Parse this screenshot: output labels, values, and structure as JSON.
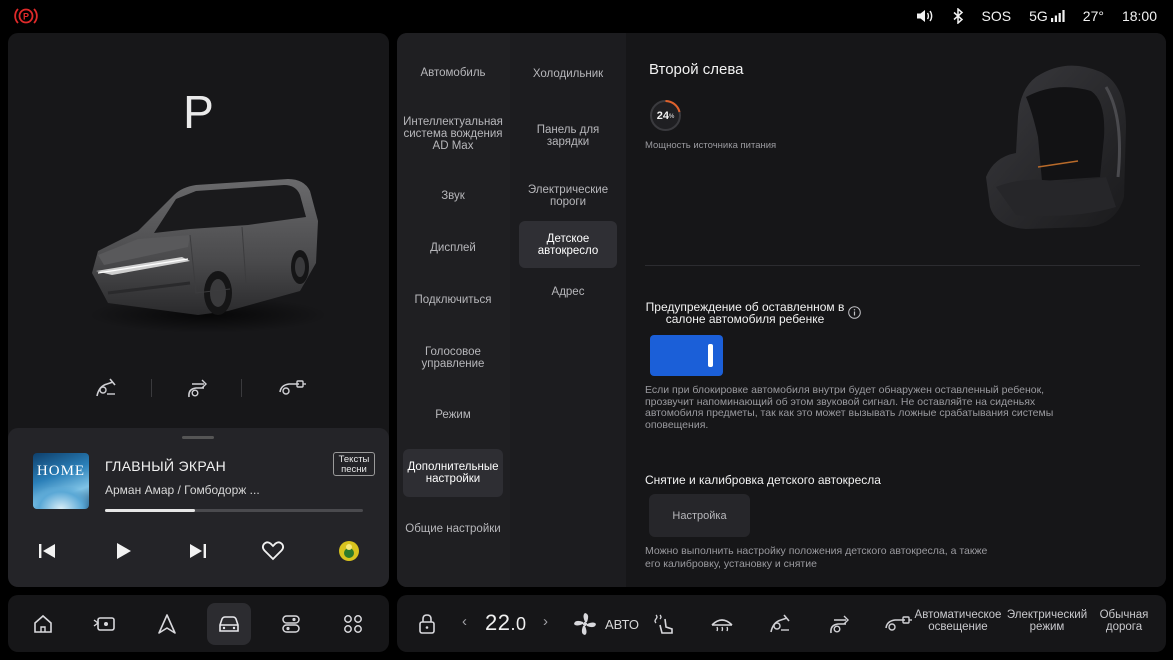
{
  "status": {
    "sos": "SOS",
    "network": "5G",
    "temperature": "27°",
    "time": "18:00",
    "brake_warning_color": "#e02a2a"
  },
  "car": {
    "gear": "P"
  },
  "media": {
    "title": "ГЛАВНЫЙ ЭКРАН",
    "artist": "Арман Амар / Гомбодорж ...",
    "lyrics_button": "Тексты песни",
    "album_text": "HOME",
    "progress": 0.35
  },
  "settings": {
    "menu": [
      {
        "label": "Автомобиль"
      },
      {
        "label": "Интеллектуальная система вождения AD Max"
      },
      {
        "label": "Звук"
      },
      {
        "label": "Дисплей"
      },
      {
        "label": "Подключиться"
      },
      {
        "label": "Голосовое управление"
      },
      {
        "label": "Режим"
      },
      {
        "label": "Дополнительные настройки",
        "active": true
      },
      {
        "label": "Общие настройки"
      }
    ],
    "submenu": [
      {
        "label": "Холодильник"
      },
      {
        "label": "Панель для зарядки"
      },
      {
        "label": "Электрические пороги"
      },
      {
        "label": "Детское автокресло",
        "active": true
      },
      {
        "label": "Адрес"
      }
    ],
    "detail": {
      "title": "Второй слева",
      "battery_value": "24",
      "battery_unit": "%",
      "battery_label": "Мощность источника питания",
      "warning_title": "Предупреждение об оставленном в салоне автомобиля ребенке",
      "warning_toggle_on": true,
      "warning_description": "Если при блокировке автомобиля внутри будет обнаружен оставленный ребенок, прозвучит напоминающий об этом звуковой сигнал. Не оставляйте на сиденьях автомобиля предметы, так как это может вызывать ложные срабатывания системы оповещения.",
      "calibration_title": "Снятие и калибровка детского автокресла",
      "calibration_button": "Настройка",
      "calibration_description": "Можно выполнить настройку положения детского автокресла, а также его калибровку, установку и снятие",
      "accent_color": "#1b5fd8"
    }
  },
  "climate": {
    "temperature_int": "22",
    "temperature_dec": ".0",
    "fan_mode": "АВТО",
    "auto_lighting": "Автоматическое освещение",
    "electric_mode": "Электрический режим",
    "normal_road": "Обычная дорога"
  }
}
